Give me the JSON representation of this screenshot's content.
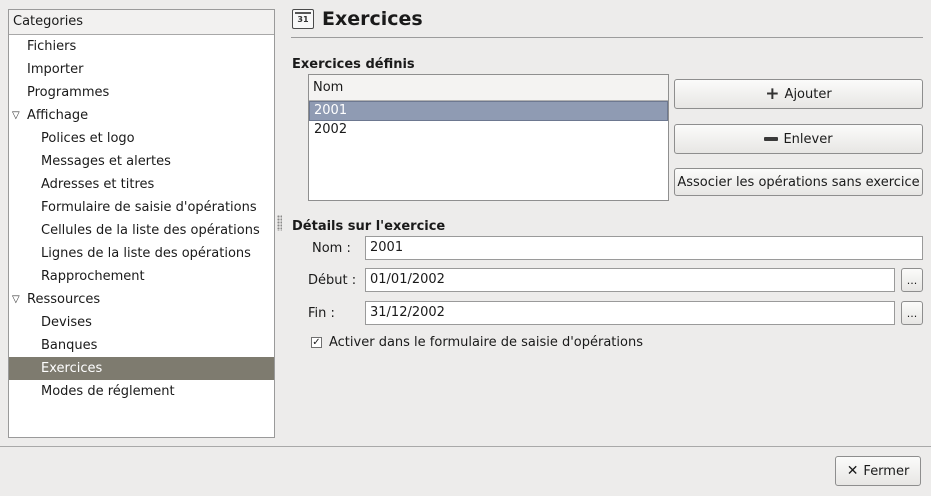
{
  "sidebar": {
    "header": "Categories",
    "items": [
      {
        "label": "Fichiers",
        "level": 0
      },
      {
        "label": "Importer",
        "level": 0
      },
      {
        "label": "Programmes",
        "level": 0
      },
      {
        "label": "Affichage",
        "level": 0,
        "expander": "▽"
      },
      {
        "label": "Polices et logo",
        "level": 1
      },
      {
        "label": "Messages et alertes",
        "level": 1
      },
      {
        "label": "Adresses et titres",
        "level": 1
      },
      {
        "label": "Formulaire de saisie d'opérations",
        "level": 1
      },
      {
        "label": "Cellules de la liste des opérations",
        "level": 1
      },
      {
        "label": "Lignes de la liste des opérations",
        "level": 1
      },
      {
        "label": "Rapprochement",
        "level": 1
      },
      {
        "label": "Ressources",
        "level": 0,
        "expander": "▽"
      },
      {
        "label": "Devises",
        "level": 1
      },
      {
        "label": "Banques",
        "level": 1
      },
      {
        "label": "Exercices",
        "level": 1,
        "selected": true
      },
      {
        "label": "Modes de réglement",
        "level": 1
      }
    ]
  },
  "page": {
    "icon": "calendar-icon",
    "icon_text": "31",
    "title": "Exercices"
  },
  "defined": {
    "section_label": "Exercices définis",
    "column_header": "Nom",
    "rows": [
      "2001",
      "2002"
    ],
    "selected_row": "2001"
  },
  "buttons": {
    "add": "Ajouter",
    "remove": "Enlever",
    "associate": "Associer les opérations sans exercice",
    "close": "Fermer",
    "date_picker": "..."
  },
  "details": {
    "section_label": "Détails sur l'exercice",
    "name_label": "Nom :",
    "name_value": "2001",
    "start_label": "Début :",
    "start_value": "01/01/2002",
    "end_label": "Fin :",
    "end_value": "31/12/2002",
    "activate_label": "Activer dans le formulaire de saisie d'opérations",
    "activate_checked": true,
    "check_mark": "✓"
  },
  "colors": {
    "selection": "#7e7b6f",
    "list_selection": "#8f9bb3",
    "background": "#edeceb"
  }
}
